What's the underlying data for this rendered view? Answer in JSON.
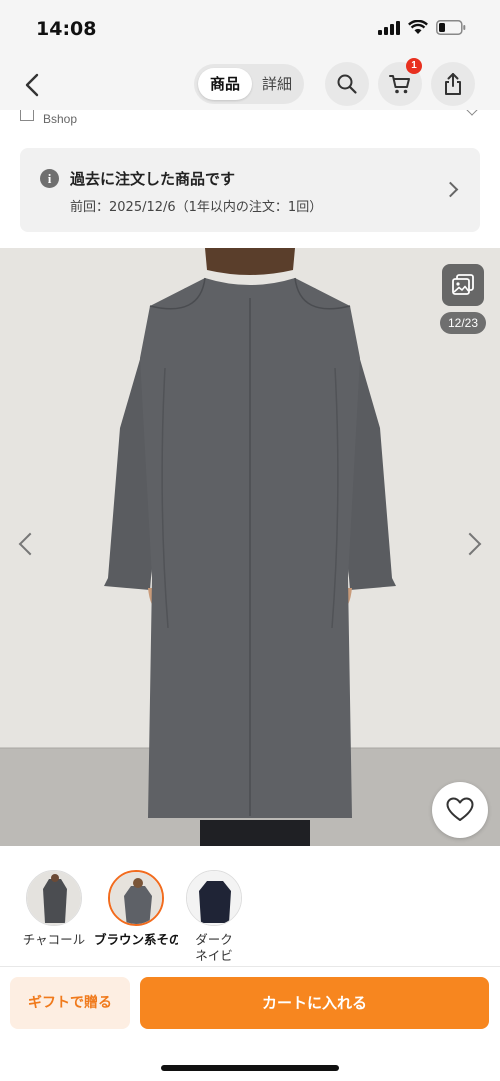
{
  "status_bar": {
    "time": "14:08"
  },
  "nav": {
    "tabs": [
      {
        "label": "商品",
        "active": true
      },
      {
        "label": "詳細",
        "active": false
      }
    ],
    "cart_badge": "1"
  },
  "shop": {
    "name": "Bshop"
  },
  "history": {
    "title": "過去に注文した商品です",
    "subtitle": "前回：2025/12/6（1年以内の注文：1回）"
  },
  "gallery": {
    "counter": "12/23"
  },
  "color_options": [
    {
      "label": "チャコール",
      "selected": false
    },
    {
      "label": "ブラウン系その他",
      "selected": true
    },
    {
      "label": "ダークネイビー",
      "selected": false
    }
  ],
  "actions": {
    "gift_label": "ギフトで贈る",
    "cart_label": "カートに入れる"
  },
  "colors": {
    "accent": "#f7861f",
    "badge": "#e8301f",
    "coat": "#5d5f63"
  }
}
